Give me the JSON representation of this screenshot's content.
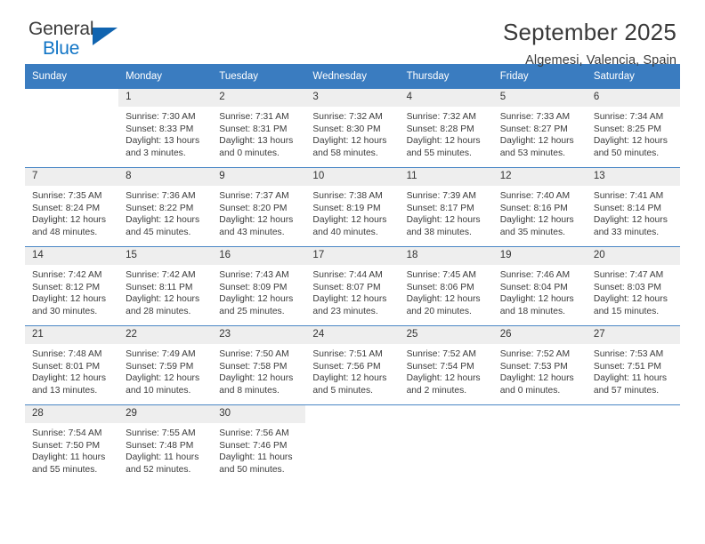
{
  "logo": {
    "line1": "General",
    "line2": "Blue",
    "triangle_color": "#1064b0",
    "accent_color": "#1175c6"
  },
  "header": {
    "title": "September 2025",
    "subtitle": "Algemesi, Valencia, Spain"
  },
  "theme": {
    "header_row_bg": "#3a7cc0",
    "daynum_bg": "#eeeeee",
    "row_divider": "#4a86c5",
    "text": "#3b3b3b"
  },
  "calendar": {
    "weekday_headers": [
      "Sunday",
      "Monday",
      "Tuesday",
      "Wednesday",
      "Thursday",
      "Friday",
      "Saturday"
    ],
    "weeks": [
      [
        {
          "day": "",
          "sunrise": "",
          "sunset": "",
          "daylight1": "",
          "daylight2": ""
        },
        {
          "day": "1",
          "sunrise": "Sunrise: 7:30 AM",
          "sunset": "Sunset: 8:33 PM",
          "daylight1": "Daylight: 13 hours",
          "daylight2": "and 3 minutes."
        },
        {
          "day": "2",
          "sunrise": "Sunrise: 7:31 AM",
          "sunset": "Sunset: 8:31 PM",
          "daylight1": "Daylight: 13 hours",
          "daylight2": "and 0 minutes."
        },
        {
          "day": "3",
          "sunrise": "Sunrise: 7:32 AM",
          "sunset": "Sunset: 8:30 PM",
          "daylight1": "Daylight: 12 hours",
          "daylight2": "and 58 minutes."
        },
        {
          "day": "4",
          "sunrise": "Sunrise: 7:32 AM",
          "sunset": "Sunset: 8:28 PM",
          "daylight1": "Daylight: 12 hours",
          "daylight2": "and 55 minutes."
        },
        {
          "day": "5",
          "sunrise": "Sunrise: 7:33 AM",
          "sunset": "Sunset: 8:27 PM",
          "daylight1": "Daylight: 12 hours",
          "daylight2": "and 53 minutes."
        },
        {
          "day": "6",
          "sunrise": "Sunrise: 7:34 AM",
          "sunset": "Sunset: 8:25 PM",
          "daylight1": "Daylight: 12 hours",
          "daylight2": "and 50 minutes."
        }
      ],
      [
        {
          "day": "7",
          "sunrise": "Sunrise: 7:35 AM",
          "sunset": "Sunset: 8:24 PM",
          "daylight1": "Daylight: 12 hours",
          "daylight2": "and 48 minutes."
        },
        {
          "day": "8",
          "sunrise": "Sunrise: 7:36 AM",
          "sunset": "Sunset: 8:22 PM",
          "daylight1": "Daylight: 12 hours",
          "daylight2": "and 45 minutes."
        },
        {
          "day": "9",
          "sunrise": "Sunrise: 7:37 AM",
          "sunset": "Sunset: 8:20 PM",
          "daylight1": "Daylight: 12 hours",
          "daylight2": "and 43 minutes."
        },
        {
          "day": "10",
          "sunrise": "Sunrise: 7:38 AM",
          "sunset": "Sunset: 8:19 PM",
          "daylight1": "Daylight: 12 hours",
          "daylight2": "and 40 minutes."
        },
        {
          "day": "11",
          "sunrise": "Sunrise: 7:39 AM",
          "sunset": "Sunset: 8:17 PM",
          "daylight1": "Daylight: 12 hours",
          "daylight2": "and 38 minutes."
        },
        {
          "day": "12",
          "sunrise": "Sunrise: 7:40 AM",
          "sunset": "Sunset: 8:16 PM",
          "daylight1": "Daylight: 12 hours",
          "daylight2": "and 35 minutes."
        },
        {
          "day": "13",
          "sunrise": "Sunrise: 7:41 AM",
          "sunset": "Sunset: 8:14 PM",
          "daylight1": "Daylight: 12 hours",
          "daylight2": "and 33 minutes."
        }
      ],
      [
        {
          "day": "14",
          "sunrise": "Sunrise: 7:42 AM",
          "sunset": "Sunset: 8:12 PM",
          "daylight1": "Daylight: 12 hours",
          "daylight2": "and 30 minutes."
        },
        {
          "day": "15",
          "sunrise": "Sunrise: 7:42 AM",
          "sunset": "Sunset: 8:11 PM",
          "daylight1": "Daylight: 12 hours",
          "daylight2": "and 28 minutes."
        },
        {
          "day": "16",
          "sunrise": "Sunrise: 7:43 AM",
          "sunset": "Sunset: 8:09 PM",
          "daylight1": "Daylight: 12 hours",
          "daylight2": "and 25 minutes."
        },
        {
          "day": "17",
          "sunrise": "Sunrise: 7:44 AM",
          "sunset": "Sunset: 8:07 PM",
          "daylight1": "Daylight: 12 hours",
          "daylight2": "and 23 minutes."
        },
        {
          "day": "18",
          "sunrise": "Sunrise: 7:45 AM",
          "sunset": "Sunset: 8:06 PM",
          "daylight1": "Daylight: 12 hours",
          "daylight2": "and 20 minutes."
        },
        {
          "day": "19",
          "sunrise": "Sunrise: 7:46 AM",
          "sunset": "Sunset: 8:04 PM",
          "daylight1": "Daylight: 12 hours",
          "daylight2": "and 18 minutes."
        },
        {
          "day": "20",
          "sunrise": "Sunrise: 7:47 AM",
          "sunset": "Sunset: 8:03 PM",
          "daylight1": "Daylight: 12 hours",
          "daylight2": "and 15 minutes."
        }
      ],
      [
        {
          "day": "21",
          "sunrise": "Sunrise: 7:48 AM",
          "sunset": "Sunset: 8:01 PM",
          "daylight1": "Daylight: 12 hours",
          "daylight2": "and 13 minutes."
        },
        {
          "day": "22",
          "sunrise": "Sunrise: 7:49 AM",
          "sunset": "Sunset: 7:59 PM",
          "daylight1": "Daylight: 12 hours",
          "daylight2": "and 10 minutes."
        },
        {
          "day": "23",
          "sunrise": "Sunrise: 7:50 AM",
          "sunset": "Sunset: 7:58 PM",
          "daylight1": "Daylight: 12 hours",
          "daylight2": "and 8 minutes."
        },
        {
          "day": "24",
          "sunrise": "Sunrise: 7:51 AM",
          "sunset": "Sunset: 7:56 PM",
          "daylight1": "Daylight: 12 hours",
          "daylight2": "and 5 minutes."
        },
        {
          "day": "25",
          "sunrise": "Sunrise: 7:52 AM",
          "sunset": "Sunset: 7:54 PM",
          "daylight1": "Daylight: 12 hours",
          "daylight2": "and 2 minutes."
        },
        {
          "day": "26",
          "sunrise": "Sunrise: 7:52 AM",
          "sunset": "Sunset: 7:53 PM",
          "daylight1": "Daylight: 12 hours",
          "daylight2": "and 0 minutes."
        },
        {
          "day": "27",
          "sunrise": "Sunrise: 7:53 AM",
          "sunset": "Sunset: 7:51 PM",
          "daylight1": "Daylight: 11 hours",
          "daylight2": "and 57 minutes."
        }
      ],
      [
        {
          "day": "28",
          "sunrise": "Sunrise: 7:54 AM",
          "sunset": "Sunset: 7:50 PM",
          "daylight1": "Daylight: 11 hours",
          "daylight2": "and 55 minutes."
        },
        {
          "day": "29",
          "sunrise": "Sunrise: 7:55 AM",
          "sunset": "Sunset: 7:48 PM",
          "daylight1": "Daylight: 11 hours",
          "daylight2": "and 52 minutes."
        },
        {
          "day": "30",
          "sunrise": "Sunrise: 7:56 AM",
          "sunset": "Sunset: 7:46 PM",
          "daylight1": "Daylight: 11 hours",
          "daylight2": "and 50 minutes."
        },
        {
          "day": "",
          "sunrise": "",
          "sunset": "",
          "daylight1": "",
          "daylight2": ""
        },
        {
          "day": "",
          "sunrise": "",
          "sunset": "",
          "daylight1": "",
          "daylight2": ""
        },
        {
          "day": "",
          "sunrise": "",
          "sunset": "",
          "daylight1": "",
          "daylight2": ""
        },
        {
          "day": "",
          "sunrise": "",
          "sunset": "",
          "daylight1": "",
          "daylight2": ""
        }
      ]
    ]
  }
}
